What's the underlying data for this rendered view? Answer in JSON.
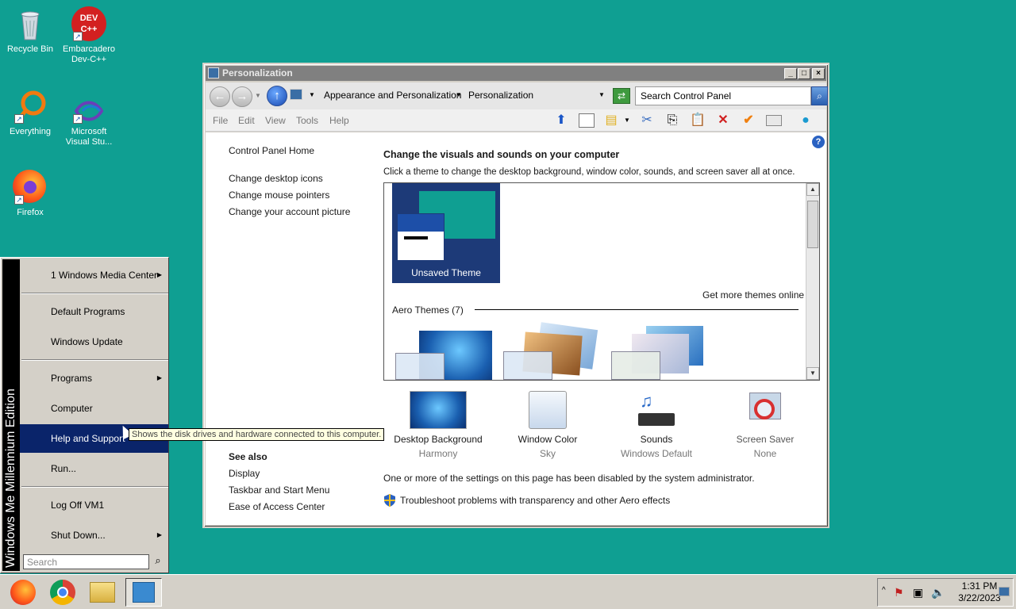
{
  "desktop": {
    "icons": [
      {
        "label": "Recycle Bin"
      },
      {
        "label": "Embarcadero Dev-C++",
        "badge": "DEV C++"
      },
      {
        "label": "Everything"
      },
      {
        "label": "Microsoft Visual Stu..."
      },
      {
        "label": "Firefox"
      }
    ]
  },
  "window": {
    "title": "Personalization",
    "breadcrumb": [
      "Appearance and Personalization",
      "Personalization"
    ],
    "search_placeholder": "Search Control Panel",
    "menu": [
      "File",
      "Edit",
      "View",
      "Tools",
      "Help"
    ],
    "left_links": [
      "Control Panel Home",
      "Change desktop icons",
      "Change mouse pointers",
      "Change your account picture"
    ],
    "see_also_title": "See also",
    "see_also": [
      "Display",
      "Taskbar and Start Menu",
      "Ease of Access Center"
    ],
    "heading": "Change the visuals and sounds on your computer",
    "subheading": "Click a theme to change the desktop background, window color, sounds, and screen saver all at once.",
    "unsaved_theme": "Unsaved Theme",
    "more_themes": "Get more themes online",
    "aero_group": "Aero Themes (7)",
    "bottom": [
      {
        "label": "Desktop Background",
        "sub": "Harmony"
      },
      {
        "label": "Window Color",
        "sub": "Sky"
      },
      {
        "label": "Sounds",
        "sub": "Windows Default"
      },
      {
        "label": "Screen Saver",
        "sub": "None"
      }
    ],
    "disabled_note": "One or more of the settings on this page has been disabled by the system administrator.",
    "troubleshoot": "Troubleshoot problems with transparency and other Aero effects"
  },
  "start_menu": {
    "sidebar": "Windows Me Millennium Edition",
    "items": [
      "1 Windows Media Center",
      "Default Programs",
      "Windows Update",
      "Programs",
      "Computer",
      "Help and Support",
      "Run...",
      "Log Off VM1",
      "Shut Down..."
    ],
    "search_placeholder": "Search"
  },
  "tooltip": "Shows the disk drives and hardware connected to this computer.",
  "taskbar": {
    "time": "1:31 PM",
    "date": "3/22/2023"
  },
  "colors": {
    "desktop": "#0f9f92",
    "highlight": "#0a246a",
    "theme_tile": "#1d3a78"
  }
}
